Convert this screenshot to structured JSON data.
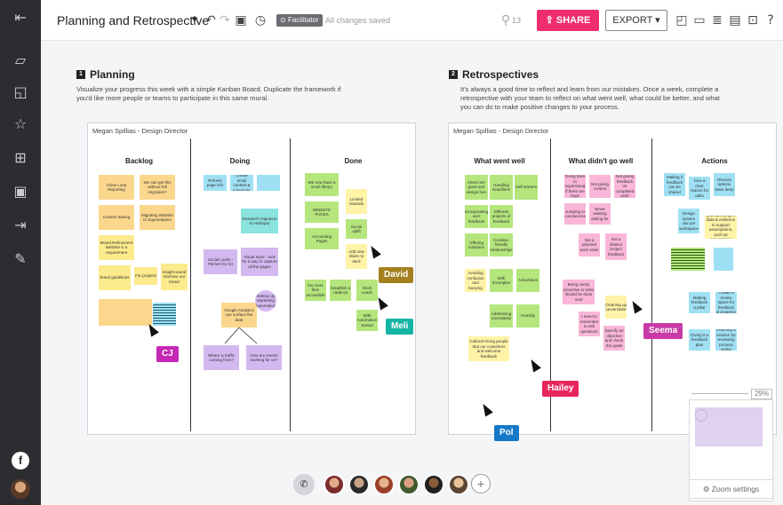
{
  "sidebar": {
    "icons": [
      "exit-icon",
      "sticky-note-icon",
      "shapes-icon",
      "star-icon",
      "grid-icon",
      "image-icon",
      "import-icon",
      "pen-icon"
    ]
  },
  "header": {
    "title": "Planning and Retrospective",
    "facilitator_label": "Facilitator",
    "save_status": "All changes saved",
    "people_count": "13",
    "share_label": "SHARE",
    "export_label": "EXPORT"
  },
  "planning": {
    "num": "1",
    "title": "Planning",
    "description_1": "Visualize your progress this week with a simple Kanban Board. Duplicate the framework if",
    "description_2": "you'd like more people or teams to participate in this same mural.",
    "owner": "Megan Spillias - Design Director",
    "columns": [
      "Backlog",
      "Doing",
      "Done"
    ],
    "notes": {
      "n1": "Close Loop Reporting",
      "n2": "We can get this without full migration?",
      "n3": "Custom Saving",
      "n4": "Migrating Website to Squarespace",
      "n5": "Brand Refinement Website is a requirement",
      "n6": "brand guidelines",
      "n7": "For projects",
      "n8": "Insight sound machine our brand",
      "n9": "Refresh page info",
      "n10": "Create email content & scheduler",
      "n11": "Research migration to HubSpot",
      "n12": "Social Looks - Pitches for S4",
      "n13": "Visual Input - look for a way to capture all the pages",
      "n14": "Google Analytics can surface the data",
      "n15": "Setting Up Marketing Automation",
      "n16": "Where is traffic coming from?",
      "n17": "How are events working for us?",
      "n18": "We now have a small library",
      "n19": "WEBSITE PAGES",
      "n20": "Accounting Pages",
      "n21": "Limited rewards",
      "n22": "Social uplift",
      "n23": "Add new slides to deck",
      "n24": "Stand-alone landing pages",
      "n25": "No more files accessible",
      "n26": "Establish a cadence",
      "n27": "Work Leads",
      "n28": "With Automation Sorted"
    }
  },
  "retro": {
    "num": "2",
    "title": "Retrospectives",
    "description_1": "It's always a good time to reflect and learn from our mistakes. Once a week, complete a",
    "description_2": "retrospective with your team to reflect on what went well, what could be better, and what",
    "description_3": "you can do to make positive changes to your process.",
    "owner": "Megan Spillias - Design Director",
    "columns": [
      "What went well",
      "What didn't go well",
      "Actions"
    ],
    "notes": {
      "r1": "Hired one great and design hire",
      "r2": "Handling Deadlines",
      "r3": "Self starters",
      "r4": "Incorporating user feedback",
      "r5": "Different projects of feedback",
      "r6": "Offering solutions",
      "r7": "Creative, friendly relationships",
      "r8": "Avoiding confusion and busying",
      "r9": "With Examples",
      "r10": "Articulation",
      "r11": "Addressing uncertainty",
      "r12": "Humility",
      "r13": "Cultural Hiring people that our coworkers and welcome feedback",
      "w1": "Going back to supervising if there are bugs",
      "w2": "Not giving context",
      "w3": "Not giving feedback on completed work",
      "w4": "Jumping to conclusions",
      "w5": "Never wasting asking for",
      "w6": "Not a planned work order",
      "w7": "Not a distinct project feedback",
      "w8": "Being overly proactive in what should be done next",
      "w9": "Cleaning up conversation",
      "w10": "I need to remember to ask questions",
      "w11": "Specify an objective and check the goals",
      "a1": "Making it feedback can be shared",
      "a2": "Give a clear reason for edits",
      "a3": "Discuss options team deep",
      "a4": "Design system use per workspace",
      "a5": "you can bring in data & evidence to support assumptions, such as conversions",
      "a6": "Making feedback a pillar",
      "a7": "Create a review space for feedback & progress",
      "a8": "Giving it a feedback plan",
      "a9": "Planning a session for reviewing process works"
    }
  },
  "cursors": {
    "cj": "CJ",
    "david": "David",
    "meli": "Meli",
    "pol": "Pol",
    "hailey": "Hailey",
    "seema": "Seema"
  },
  "colors": {
    "share": "#ee2e6c",
    "cj": "#c528b4",
    "david": "#a37f1e",
    "meli": "#16b4a4",
    "pol": "#1478c8",
    "hailey": "#e8265e",
    "seema": "#c93aa6"
  },
  "bottom": {
    "avatars": [
      "user-1",
      "user-2",
      "user-3",
      "user-4",
      "user-5",
      "user-6"
    ]
  },
  "zoom": {
    "level": "29%",
    "settings_label": "Zoom settings"
  }
}
